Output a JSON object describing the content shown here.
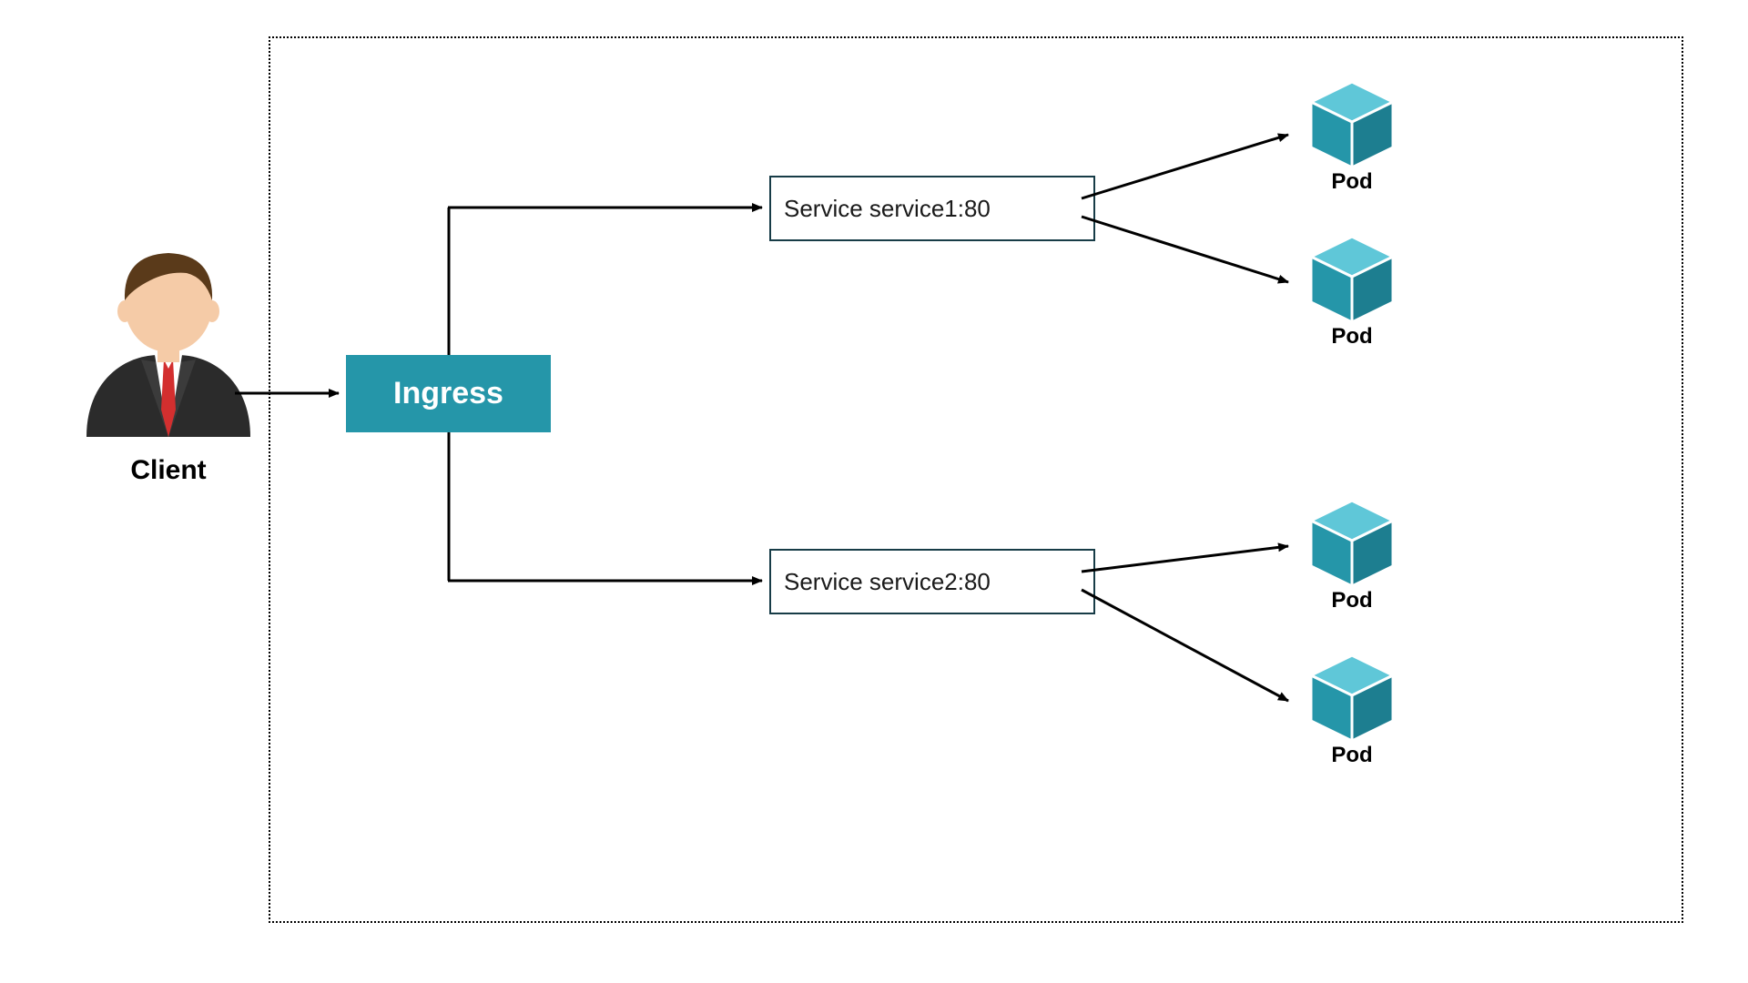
{
  "colors": {
    "accent": "#2596a9",
    "cube_light": "#39b3c7",
    "cube_dark": "#1d7e90",
    "border_dark": "#173c47"
  },
  "client": {
    "label": "Client"
  },
  "ingress": {
    "label": "Ingress"
  },
  "services": [
    {
      "label": "Service service1:80"
    },
    {
      "label": "Service service2:80"
    }
  ],
  "pods": [
    {
      "label": "Pod"
    },
    {
      "label": "Pod"
    },
    {
      "label": "Pod"
    },
    {
      "label": "Pod"
    }
  ]
}
